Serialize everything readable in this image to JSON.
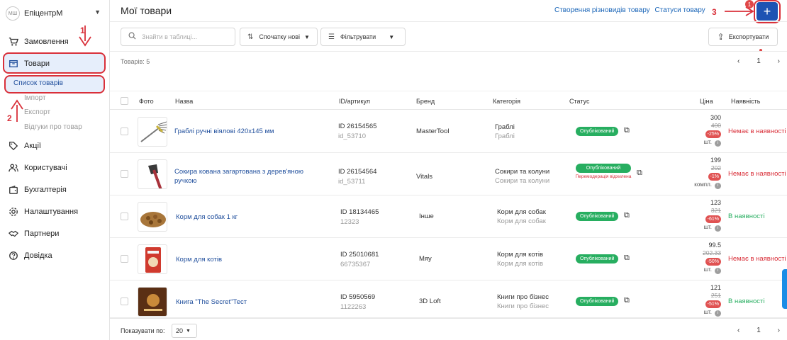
{
  "sidebar": {
    "brand_initials": "МШ",
    "brand_name": "ЕпіцентрМ",
    "items": [
      {
        "label": "Замовлення",
        "icon": "cart-icon"
      },
      {
        "label": "Товари",
        "icon": "box-icon"
      },
      {
        "label": "Акції",
        "icon": "tag-icon"
      },
      {
        "label": "Користувачі",
        "icon": "users-icon"
      },
      {
        "label": "Бухгалтерія",
        "icon": "wallet-icon"
      },
      {
        "label": "Налаштування",
        "icon": "gear-icon"
      },
      {
        "label": "Партнери",
        "icon": "handshake-icon"
      },
      {
        "label": "Довідка",
        "icon": "help-icon"
      }
    ],
    "subitems": [
      "Список товарів",
      "Імпорт",
      "Експорт",
      "Відгуки про товар"
    ]
  },
  "header": {
    "title": "Мої товари",
    "link_variants": "Створення різновидів товару",
    "link_statuses": "Статуси товару",
    "add_label": "+",
    "add_badge": "1"
  },
  "annotations": [
    "1",
    "2",
    "3"
  ],
  "toolbar": {
    "search_placeholder": "Знайти в таблиці...",
    "sort_label": "Спочатку нові",
    "filter_label": "Фільтрувати",
    "export_label": "Експортувати"
  },
  "summary": {
    "count_label": "Товарів: 5",
    "page": "1"
  },
  "columns": [
    "Фото",
    "Назва",
    "ID/артикул",
    "Бренд",
    "Категорія",
    "Статус",
    "Ціна",
    "Наявність"
  ],
  "products": [
    {
      "name": "Граблі ручні віялові 420х145 мм",
      "id": "ID 26154565",
      "sku": "id_53710",
      "brand": "MasterTool",
      "category": "Граблі",
      "category_sub": "Граблі",
      "status": "Опублікований",
      "moderation": "",
      "price": "300",
      "old_price": "400",
      "discount": "-25%",
      "unit": "шт.",
      "availability": "Немає в наявності",
      "in_stock": false,
      "thumb": "rake"
    },
    {
      "name": "Сокира кована загартована з дерев'яною ручкою",
      "id": "ID 26154564",
      "sku": "id_53711",
      "brand": "Vitals",
      "category": "Сокири та колуни",
      "category_sub": "Сокири та колуни",
      "status": "Опублікований",
      "moderation": "Перемодерація відхилена",
      "price": "199",
      "old_price": "202",
      "discount": "-1%",
      "unit": "компл.",
      "availability": "Немає в наявності",
      "in_stock": false,
      "thumb": "axe"
    },
    {
      "name": "Корм для собак 1 кг",
      "id": "ID 18134465",
      "sku": "12323",
      "brand": "Інше",
      "category": "Корм для собак",
      "category_sub": "Корм для собак",
      "status": "Опублікований",
      "moderation": "",
      "price": "123",
      "old_price": "321",
      "discount": "-61%",
      "unit": "шт.",
      "availability": "В наявності",
      "in_stock": true,
      "thumb": "dogfood"
    },
    {
      "name": "Корм для котів",
      "id": "ID 25010681",
      "sku": "66735367",
      "brand": "Мяу",
      "category": "Корм для котів",
      "category_sub": "Корм для котів",
      "status": "Опублікований",
      "moderation": "",
      "price": "99.5",
      "old_price": "202.33",
      "discount": "-50%",
      "unit": "шт.",
      "availability": "Немає в наявності",
      "in_stock": false,
      "thumb": "catfood"
    },
    {
      "name": "Книга \"The Secret\"Тест",
      "id": "ID 5950569",
      "sku": "1122263",
      "brand": "3D Loft",
      "category": "Книги про бізнес",
      "category_sub": "Книги про бізнес",
      "status": "Опублікований",
      "moderation": "",
      "price": "121",
      "old_price": "251",
      "discount": "-51%",
      "unit": "шт.",
      "availability": "В наявності",
      "in_stock": true,
      "thumb": "book"
    }
  ],
  "footer": {
    "per_page_label": "Показувати по:",
    "per_page": "20",
    "page": "1"
  },
  "colors": {
    "accent": "#1e53b3",
    "published": "#27ae60",
    "danger": "#d9303a",
    "link": "#1b66b8"
  }
}
